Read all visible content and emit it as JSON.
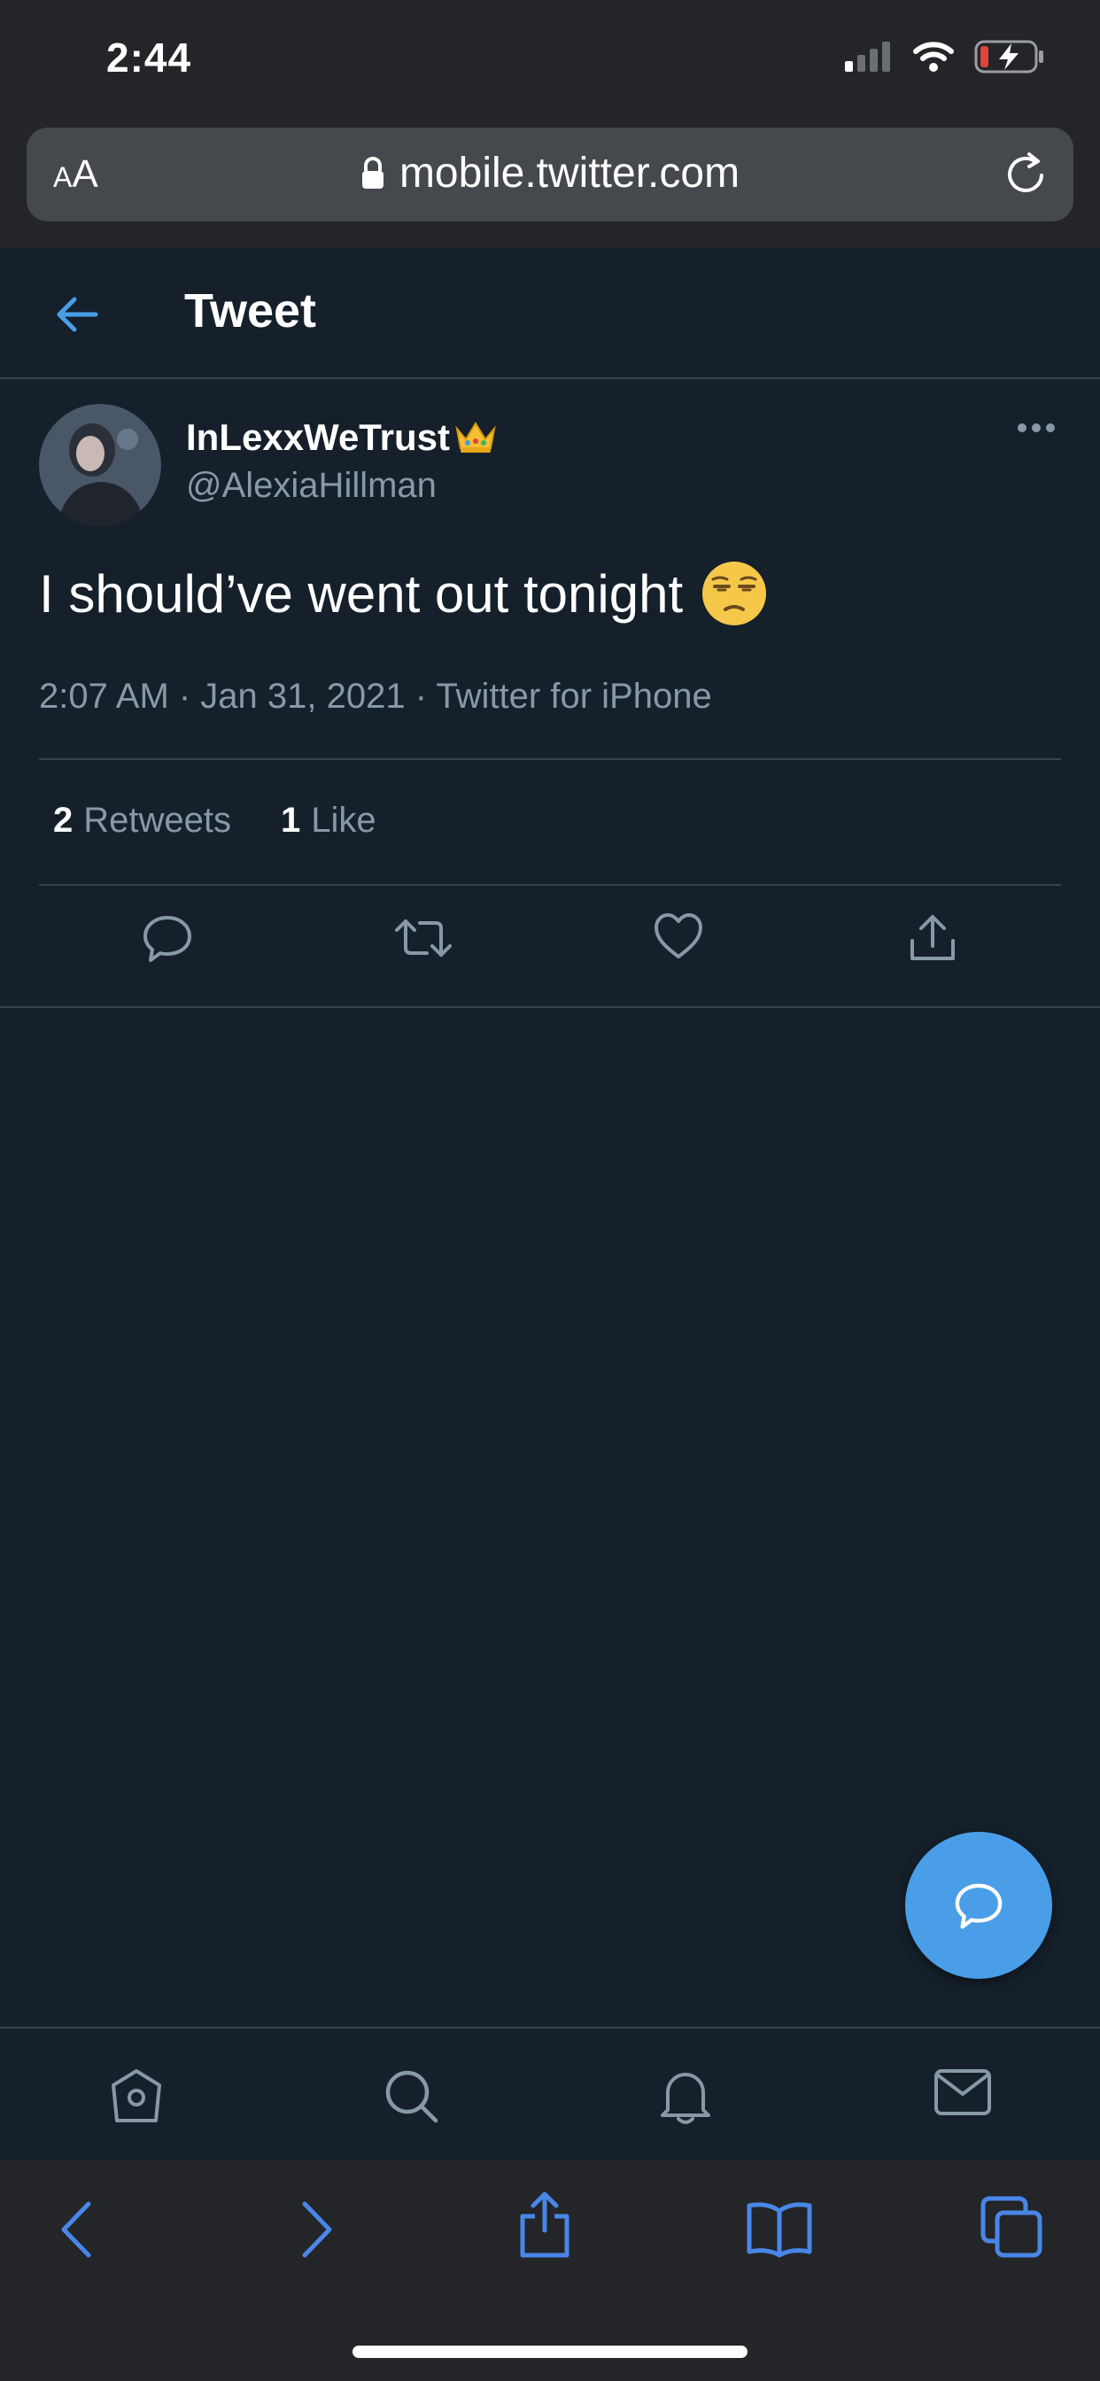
{
  "status_bar": {
    "time": "2:44"
  },
  "browser": {
    "aa_label_small": "A",
    "aa_label_large": "A",
    "url": "mobile.twitter.com"
  },
  "header": {
    "title": "Tweet"
  },
  "tweet": {
    "display_name": "InLexxWeTrust",
    "handle": "@AlexiaHillman",
    "text": "I should’ve went out tonight",
    "meta": "2:07 AM · Jan 31, 2021 · Twitter for iPhone",
    "retweets_count": "2",
    "retweets_label": "Retweets",
    "likes_count": "1",
    "likes_label": "Like"
  },
  "colors": {
    "background": "#15202b",
    "accent": "#4a9ee8",
    "secondary_text": "#8899a6",
    "divider": "#38444d",
    "safari_chrome": "#232529"
  },
  "icons": {
    "action_bar": [
      "reply-icon",
      "retweet-icon",
      "like-icon",
      "share-icon"
    ],
    "twitter_nav": [
      "home-icon",
      "search-icon",
      "notifications-icon",
      "messages-icon"
    ],
    "safari_toolbar": [
      "back-icon",
      "forward-icon",
      "share-icon",
      "bookmarks-icon",
      "tabs-icon"
    ]
  }
}
